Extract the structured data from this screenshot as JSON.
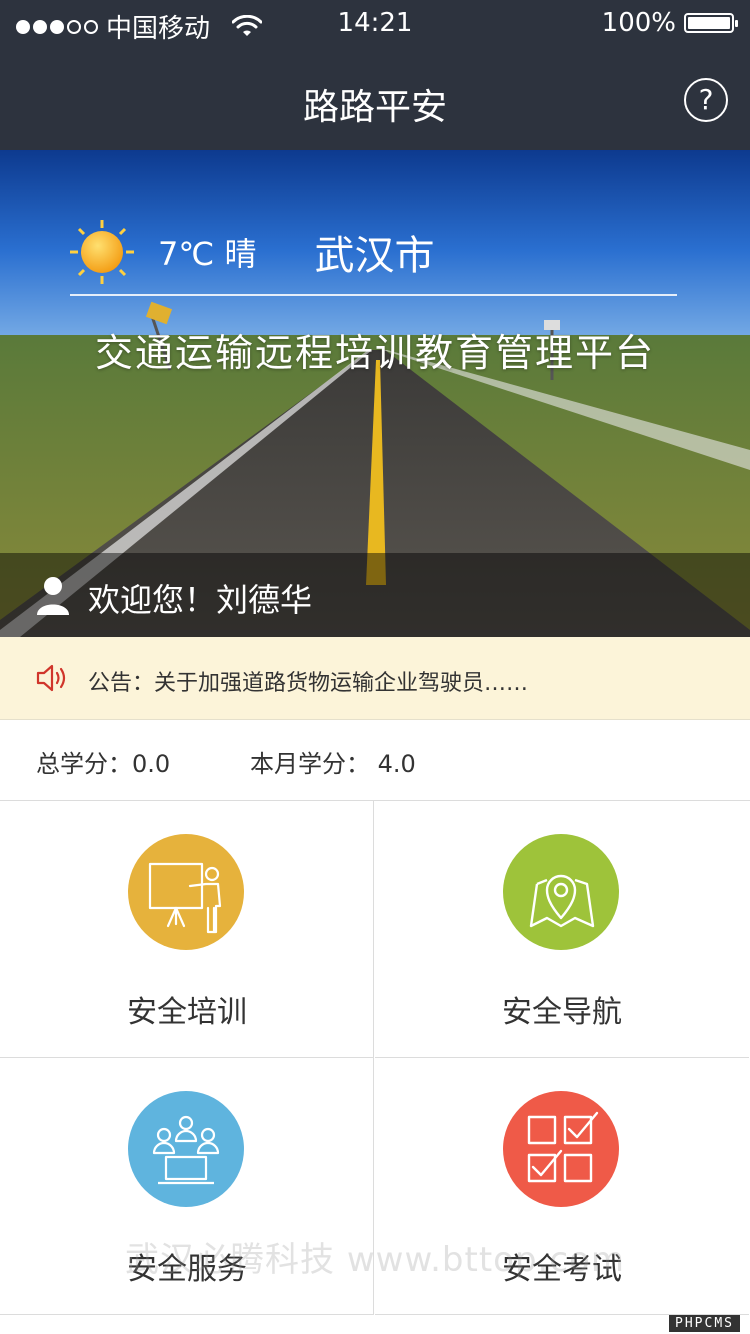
{
  "status_bar": {
    "carrier": "中国移动",
    "time": "14:21",
    "battery": "100%"
  },
  "navbar": {
    "title": "路路平安",
    "help_icon": "question-icon"
  },
  "banner": {
    "temperature": "7℃ 晴",
    "city": "武汉市",
    "title": "交通运输远程培训教育管理平台",
    "welcome": "欢迎您！刘德华"
  },
  "notice": {
    "text": "公告：关于加强道路货物运输企业驾驶员……"
  },
  "credits": {
    "total": "总学分：0.0",
    "month": "本月学分： 4.0"
  },
  "features": [
    {
      "label": "安全培训",
      "icon": "training-icon",
      "color": "#e6b23c"
    },
    {
      "label": "安全导航",
      "icon": "map-pin-icon",
      "color": "#9ec33a"
    },
    {
      "label": "安全服务",
      "icon": "service-icon",
      "color": "#5fb4de"
    },
    {
      "label": "安全考试",
      "icon": "checklist-icon",
      "color": "#ef5a48"
    }
  ],
  "watermark": "武汉必腾科技 www.bttop.com",
  "corner_badge": "PHPCMS",
  "colors": {
    "nav_bg": "#2d333e",
    "notice_bg": "#fcf4d9",
    "speaker_red": "#d0352b"
  }
}
